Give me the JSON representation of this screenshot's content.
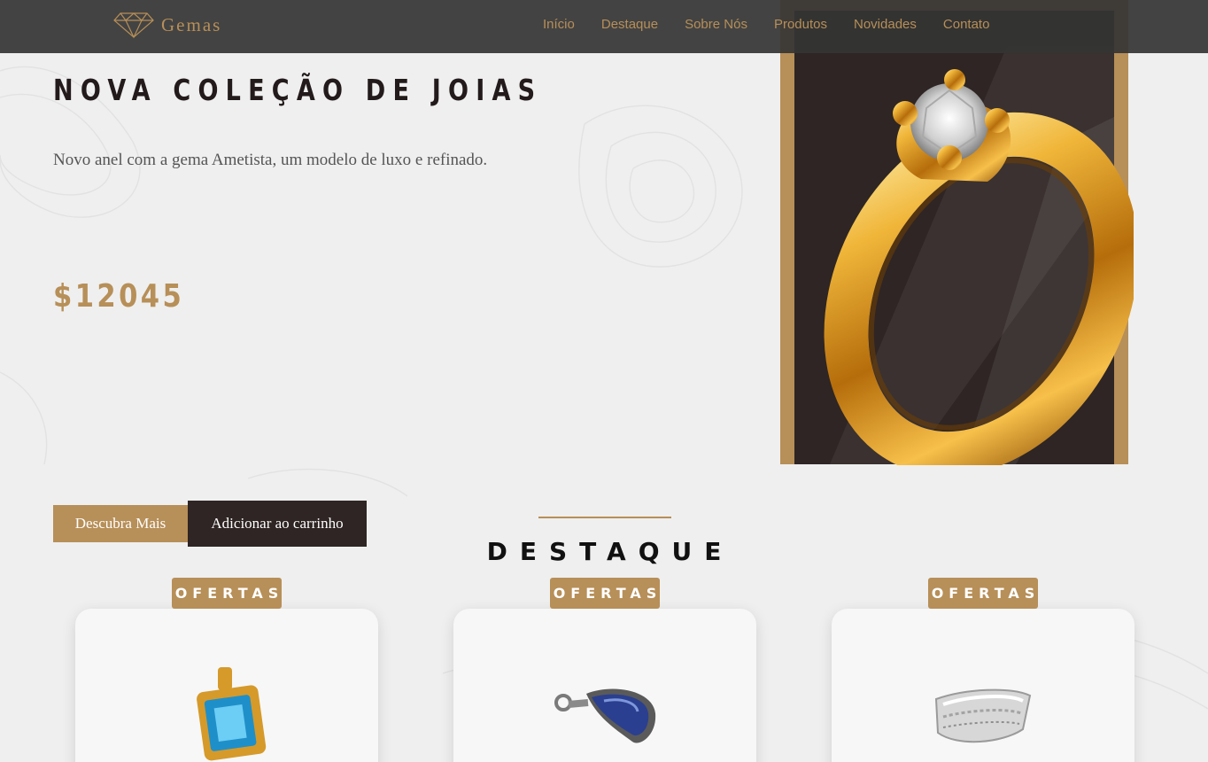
{
  "brand": {
    "name": "Gemas",
    "logo_icon": "diamond-icon"
  },
  "nav": {
    "items": [
      "Início",
      "Destaque",
      "Sobre Nós",
      "Produtos",
      "Novidades",
      "Contato"
    ]
  },
  "hero": {
    "title": "NOVA COLEÇÃO DE JOIAS",
    "description": "Novo anel com a gema Ametista, um modelo de luxo e refinado.",
    "price": "$12045",
    "image": "gold-ring-image",
    "buttons": {
      "discover": "Descubra Mais",
      "add_to_cart": "Adicionar ao carrinho"
    }
  },
  "featured": {
    "title": "DESTAQUE",
    "cards": [
      {
        "badge": "OFERTAS",
        "image": "blue-topaz-pendant-image"
      },
      {
        "badge": "OFERTAS",
        "image": "sapphire-pendant-image"
      },
      {
        "badge": "OFERTAS",
        "image": "silver-ring-image"
      }
    ]
  },
  "colors": {
    "accent": "#b78f58",
    "dark": "#2e2524",
    "header": "#343434",
    "background": "#efefef"
  }
}
